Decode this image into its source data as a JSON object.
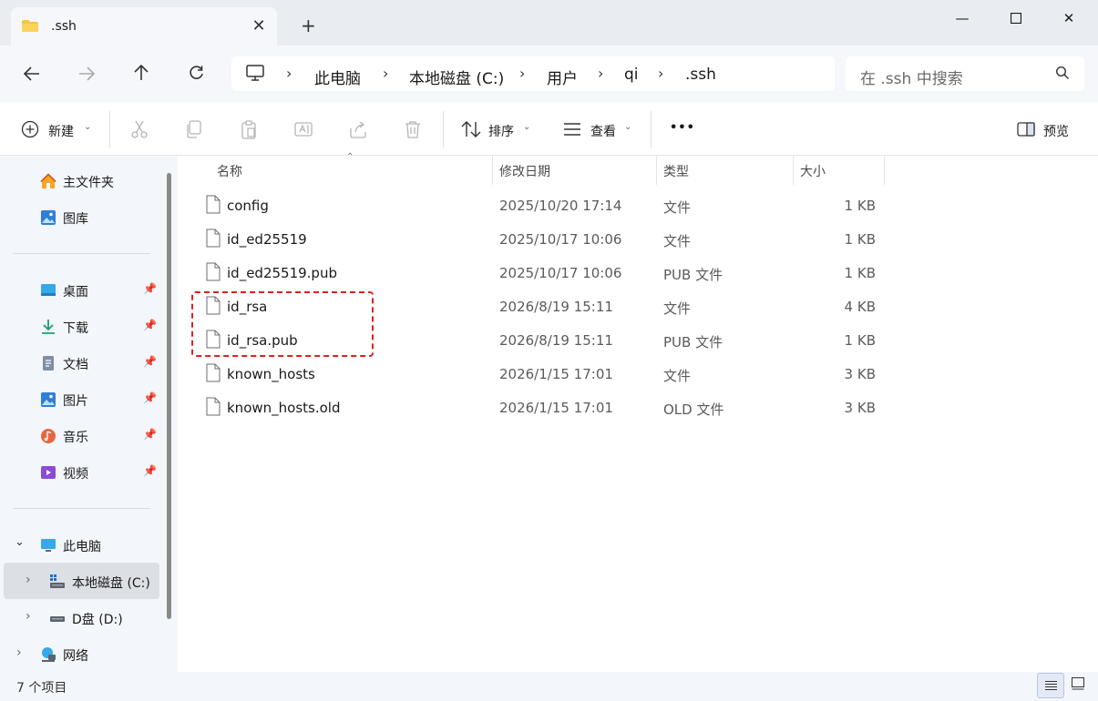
{
  "window": {
    "tab_title": ".ssh",
    "tab_close": "✕",
    "new_tab": "+",
    "minimize": "—",
    "close": "✕"
  },
  "nav": {
    "breadcrumb": [
      "此电脑",
      "本地磁盘 (C:)",
      "用户",
      "qi",
      ".ssh"
    ],
    "search_placeholder": "在 .ssh 中搜索"
  },
  "toolbar": {
    "new_label": "新建",
    "sort_label": "排序",
    "view_label": "查看",
    "more_label": "•••",
    "preview_label": "预览"
  },
  "sidebar": {
    "quick": [
      {
        "label": "主文件夹",
        "icon": "home-icon"
      },
      {
        "label": "图库",
        "icon": "gallery-icon"
      }
    ],
    "pinned": [
      {
        "label": "桌面",
        "icon": "desktop-icon"
      },
      {
        "label": "下载",
        "icon": "download-icon"
      },
      {
        "label": "文档",
        "icon": "document-icon"
      },
      {
        "label": "图片",
        "icon": "pictures-icon"
      },
      {
        "label": "音乐",
        "icon": "music-icon"
      },
      {
        "label": "视频",
        "icon": "video-icon"
      }
    ],
    "this_pc": "此电脑",
    "drive_c": "本地磁盘 (C:)",
    "drive_d": "D盘 (D:)",
    "network": "网络"
  },
  "columns": {
    "name": "名称",
    "date": "修改日期",
    "type": "类型",
    "size": "大小"
  },
  "files": [
    {
      "name": "config",
      "date": "2025/10/20 17:14",
      "type": "文件",
      "size": "1 KB"
    },
    {
      "name": "id_ed25519",
      "date": "2025/10/17 10:06",
      "type": "文件",
      "size": "1 KB"
    },
    {
      "name": "id_ed25519.pub",
      "date": "2025/10/17 10:06",
      "type": "PUB 文件",
      "size": "1 KB"
    },
    {
      "name": "id_rsa",
      "date": "2026/8/19 15:11",
      "type": "文件",
      "size": "4 KB"
    },
    {
      "name": "id_rsa.pub",
      "date": "2026/8/19 15:11",
      "type": "PUB 文件",
      "size": "1 KB"
    },
    {
      "name": "known_hosts",
      "date": "2026/1/15 17:01",
      "type": "文件",
      "size": "3 KB"
    },
    {
      "name": "known_hosts.old",
      "date": "2026/1/15 17:01",
      "type": "OLD 文件",
      "size": "3 KB"
    }
  ],
  "status": {
    "item_count": "7 个项目"
  },
  "colors": {
    "accent": "#0067c0",
    "highlight_border": "#e02020",
    "folder": "#f8c43a"
  }
}
